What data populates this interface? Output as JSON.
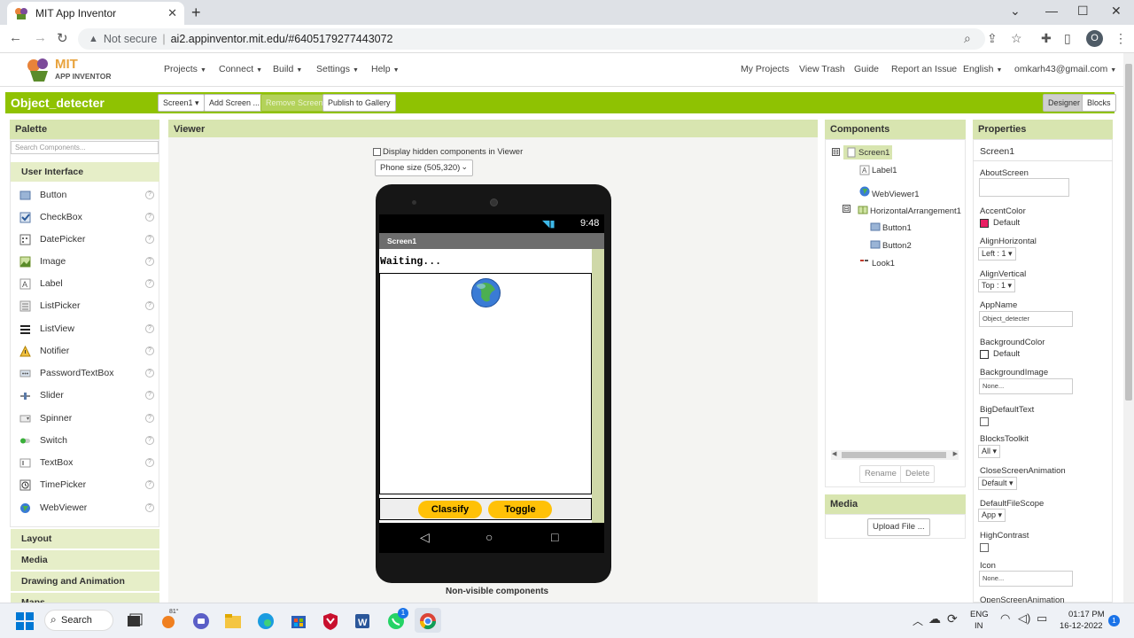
{
  "browser": {
    "tab_title": "MIT App Inventor",
    "not_secure": "Not secure",
    "url": "ai2.appinventor.mit.edu/#6405179277443072",
    "profile_initial": "O"
  },
  "nav": {
    "logo_mit": "MIT",
    "logo_sub": "APP INVENTOR",
    "menus": [
      "Projects",
      "Connect",
      "Build",
      "Settings",
      "Help"
    ],
    "right_links": [
      "My Projects",
      "View Trash",
      "Guide",
      "Report an Issue"
    ],
    "language": "English",
    "account": "omkarh43@gmail.com"
  },
  "toolbar": {
    "project_name": "Object_detecter",
    "screen_select": "Screen1",
    "add_screen": "Add Screen ...",
    "remove_screen": "Remove Screen",
    "publish": "Publish to Gallery",
    "designer": "Designer",
    "blocks": "Blocks"
  },
  "palette": {
    "title": "Palette",
    "search_placeholder": "Search Components...",
    "category_open": "User Interface",
    "items": [
      "Button",
      "CheckBox",
      "DatePicker",
      "Image",
      "Label",
      "ListPicker",
      "ListView",
      "Notifier",
      "PasswordTextBox",
      "Slider",
      "Spinner",
      "Switch",
      "TextBox",
      "TimePicker",
      "WebViewer"
    ],
    "help_glyph": "?",
    "categories": [
      "Layout",
      "Media",
      "Drawing and Animation",
      "Maps"
    ]
  },
  "viewer": {
    "title": "Viewer",
    "hidden_checkbox_label": "Display hidden components in Viewer",
    "phone_size": "Phone size (505,320)",
    "time": "9:48",
    "screen_title": "Screen1",
    "label_text": "Waiting...",
    "button1": "Classify",
    "button2": "Toggle",
    "nonvisible": "Non-visible components"
  },
  "components": {
    "title": "Components",
    "tree": [
      "Screen1",
      "Label1",
      "WebViewer1",
      "HorizontalArrangement1",
      "Button1",
      "Button2",
      "Look1"
    ],
    "expand_glyph": "⊟",
    "rename": "Rename",
    "delete": "Delete"
  },
  "media": {
    "title": "Media",
    "upload": "Upload File ..."
  },
  "properties": {
    "title": "Properties",
    "component": "Screen1",
    "about_screen": "AboutScreen",
    "accent_color": "AccentColor",
    "accent_value": "Default",
    "align_h": "AlignHorizontal",
    "align_h_value": "Left : 1",
    "align_v": "AlignVertical",
    "align_v_value": "Top : 1",
    "app_name": "AppName",
    "app_name_value": "Object_detecter",
    "bg_color": "BackgroundColor",
    "bg_color_value": "Default",
    "bg_image": "BackgroundImage",
    "bg_image_value": "None...",
    "big_text": "BigDefaultText",
    "blocks_toolkit": "BlocksToolkit",
    "blocks_toolkit_value": "All",
    "close_anim": "CloseScreenAnimation",
    "close_anim_value": "Default",
    "file_scope": "DefaultFileScope",
    "file_scope_value": "App",
    "high_contrast": "HighContrast",
    "icon": "Icon",
    "icon_value": "None...",
    "open_anim": "OpenScreenAnimation"
  },
  "taskbar": {
    "search": "Search",
    "temp": "81°",
    "whatsapp_badge": "1",
    "lang1": "ENG",
    "lang2": "IN",
    "time": "01:17 PM",
    "date": "16-12-2022",
    "notif": "1"
  },
  "colors": {
    "green": "#8fc202",
    "panel_header": "#d8e5b0",
    "accent_pink": "#e91e63",
    "button_yellow": "#ffc107"
  }
}
